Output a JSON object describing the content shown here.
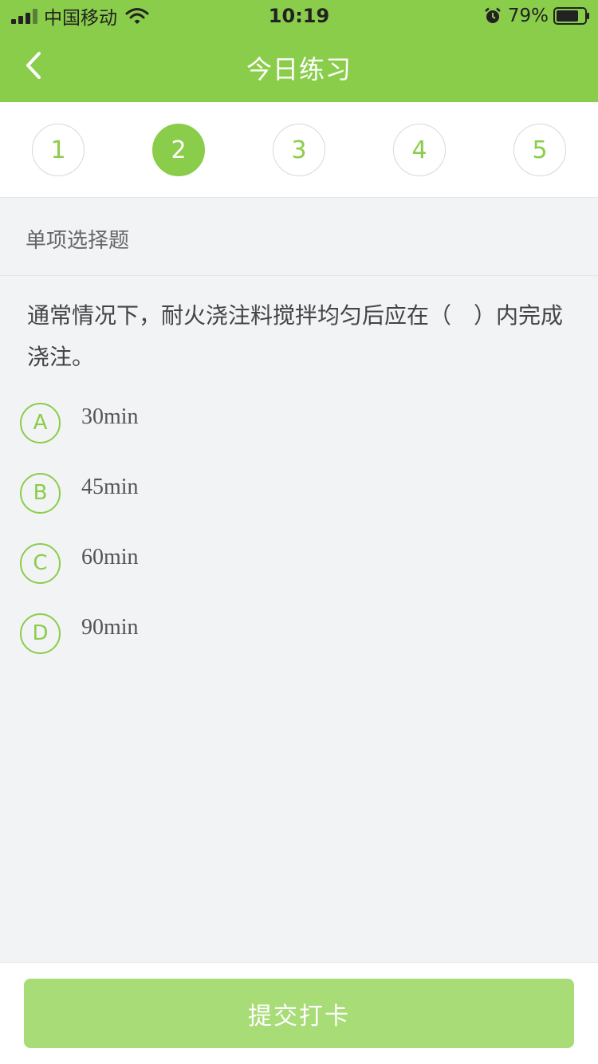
{
  "status_bar": {
    "carrier": "中国移动",
    "time": "10:19",
    "battery": "79%"
  },
  "nav": {
    "title": "今日练习",
    "back_icon": "chevron-left-icon"
  },
  "steps": {
    "items": [
      "1",
      "2",
      "3",
      "4",
      "5"
    ],
    "active_index": 1
  },
  "question_type": "单项选择题",
  "question": {
    "text": "通常情况下，耐火浇注料搅拌均匀后应在（　）内完成浇注。"
  },
  "options": [
    {
      "letter": "A",
      "text": "30min"
    },
    {
      "letter": "B",
      "text": "45min"
    },
    {
      "letter": "C",
      "text": "60min"
    },
    {
      "letter": "D",
      "text": "90min"
    }
  ],
  "footer": {
    "submit_label": "提交打卡"
  },
  "colors": {
    "brand": "#8acd4a",
    "submit_disabled": "#a8dc77",
    "background": "#f2f3f5"
  }
}
